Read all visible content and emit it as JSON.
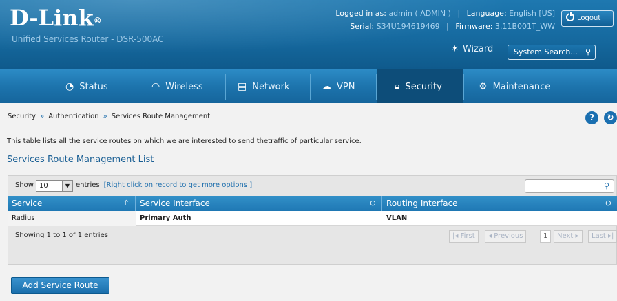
{
  "brand": {
    "logo": "D-Link",
    "trademark": "®",
    "product": "Unified Services Router - DSR-500AC"
  },
  "session": {
    "logged_in_label": "Logged in as:",
    "user": "admin ( ADMIN )",
    "language_label": "Language:",
    "language": "English [US]",
    "serial_label": "Serial:",
    "serial": "S34U194619469",
    "firmware_label": "Firmware:",
    "firmware": "3.11B001T_WW",
    "logout_label": "Logout"
  },
  "header": {
    "wizard_label": "Wizard",
    "search_placeholder": "System Search..."
  },
  "nav": {
    "items": [
      {
        "label": "Status",
        "icon": "gauge-icon"
      },
      {
        "label": "Wireless",
        "icon": "wifi-icon"
      },
      {
        "label": "Network",
        "icon": "monitor-icon"
      },
      {
        "label": "VPN",
        "icon": "cloud-lock-icon"
      },
      {
        "label": "Security",
        "icon": "lock-icon",
        "active": true
      },
      {
        "label": "Maintenance",
        "icon": "gear-icon"
      }
    ]
  },
  "breadcrumb": [
    "Security",
    "Authentication",
    "Services Route Management"
  ],
  "page": {
    "description": "This table lists all the service routes on which we are interested to send thetraffic of particular service.",
    "list_title": "Services Route Management List"
  },
  "table": {
    "show_label": "Show",
    "page_size": "10",
    "entries_label": "entries",
    "hint": "[Right click on record to get more options ]",
    "columns": [
      "Service",
      "Service Interface",
      "Routing Interface"
    ],
    "rows": [
      [
        "Radius",
        "Primary Auth",
        "VLAN"
      ]
    ],
    "info": "Showing 1 to 1 of 1 entries",
    "pager": {
      "first": "First",
      "previous": "Previous",
      "current": "1",
      "next": "Next",
      "last": "Last"
    }
  },
  "actions": {
    "add_label": "Add Service Route"
  },
  "colors": {
    "header_blue": "#1a70a8",
    "nav_active": "#0d4d79",
    "title_blue": "#1a5f94"
  }
}
